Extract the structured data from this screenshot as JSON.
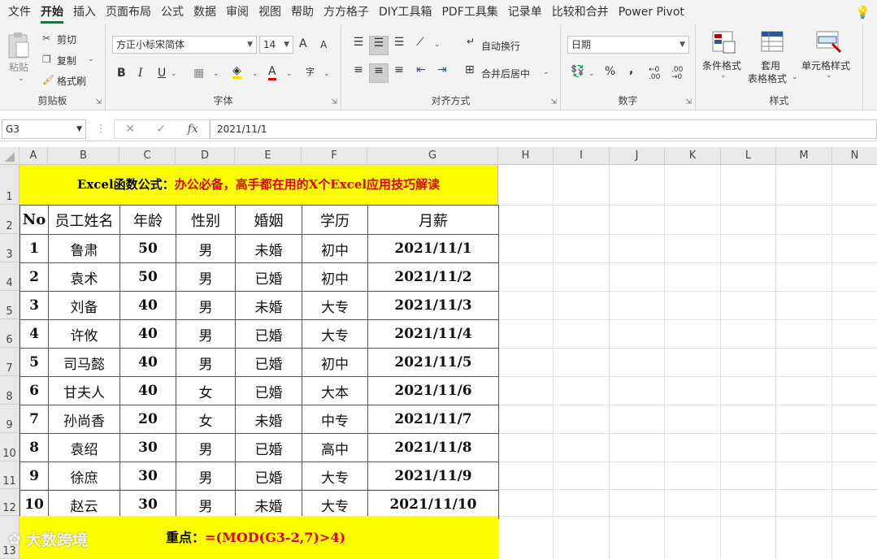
{
  "menu": [
    "文件",
    "开始",
    "插入",
    "页面布局",
    "公式",
    "数据",
    "审阅",
    "视图",
    "帮助",
    "方方格子",
    "DIY工具箱",
    "PDF工具集",
    "记录单",
    "比较和合并",
    "Power Pivot"
  ],
  "ribbon": {
    "clipboard": {
      "paste": "粘贴",
      "cut": "剪切",
      "copy": "复制",
      "format_painter": "格式刷",
      "label": "剪贴板"
    },
    "font": {
      "name": "方正小标宋简体",
      "size": "14",
      "grow": "A",
      "shrink": "A",
      "bold": "B",
      "italic": "I",
      "underline": "U",
      "font_color": "A",
      "phonetic": "字",
      "label": "字体"
    },
    "alignment": {
      "wrap": "自动换行",
      "merge": "合并后居中",
      "label": "对齐方式"
    },
    "number": {
      "format": "日期",
      "percent": "%",
      "comma": ",",
      "inc_dec": "←0 .00",
      "dec_dec": ".00 →0",
      "label": "数字"
    },
    "styles": {
      "conditional": "条件格式",
      "table_line1": "套用",
      "table_line2": "表格格式",
      "cell_styles": "单元格样式",
      "label": "样式"
    }
  },
  "formula_bar": {
    "name_box": "G3",
    "fx": "fx",
    "value": "2021/11/1"
  },
  "columns": [
    "A",
    "B",
    "C",
    "D",
    "E",
    "F",
    "G",
    "H",
    "I",
    "J",
    "K",
    "L",
    "M",
    "N"
  ],
  "rows": [
    "1",
    "2",
    "3",
    "4",
    "5",
    "6",
    "7",
    "8",
    "9",
    "10",
    "11",
    "12",
    "13"
  ],
  "sheet": {
    "title_black": "Excel函数公式：",
    "title_red": "办公必备，高手都在用的X个Excel应用技巧解读",
    "headers": [
      "No",
      "员工姓名",
      "年龄",
      "性别",
      "婚姻",
      "学历",
      "月薪"
    ],
    "data": [
      [
        "1",
        "鲁肃",
        "50",
        "男",
        "未婚",
        "初中",
        "2021/11/1"
      ],
      [
        "2",
        "袁术",
        "50",
        "男",
        "已婚",
        "初中",
        "2021/11/2"
      ],
      [
        "3",
        "刘备",
        "40",
        "男",
        "未婚",
        "大专",
        "2021/11/3"
      ],
      [
        "4",
        "许攸",
        "40",
        "男",
        "已婚",
        "大专",
        "2021/11/4"
      ],
      [
        "5",
        "司马懿",
        "40",
        "男",
        "已婚",
        "初中",
        "2021/11/5"
      ],
      [
        "6",
        "甘夫人",
        "40",
        "女",
        "已婚",
        "大本",
        "2021/11/6"
      ],
      [
        "7",
        "孙尚香",
        "20",
        "女",
        "未婚",
        "中专",
        "2021/11/7"
      ],
      [
        "8",
        "袁绍",
        "30",
        "男",
        "已婚",
        "高中",
        "2021/11/8"
      ],
      [
        "9",
        "徐庶",
        "30",
        "男",
        "已婚",
        "大专",
        "2021/11/9"
      ],
      [
        "10",
        "赵云",
        "30",
        "男",
        "未婚",
        "大专",
        "2021/11/10"
      ]
    ],
    "note_label": "重点：",
    "note_formula": "=(MOD(G3-2,7)>4)"
  },
  "watermark": "大数跨境"
}
